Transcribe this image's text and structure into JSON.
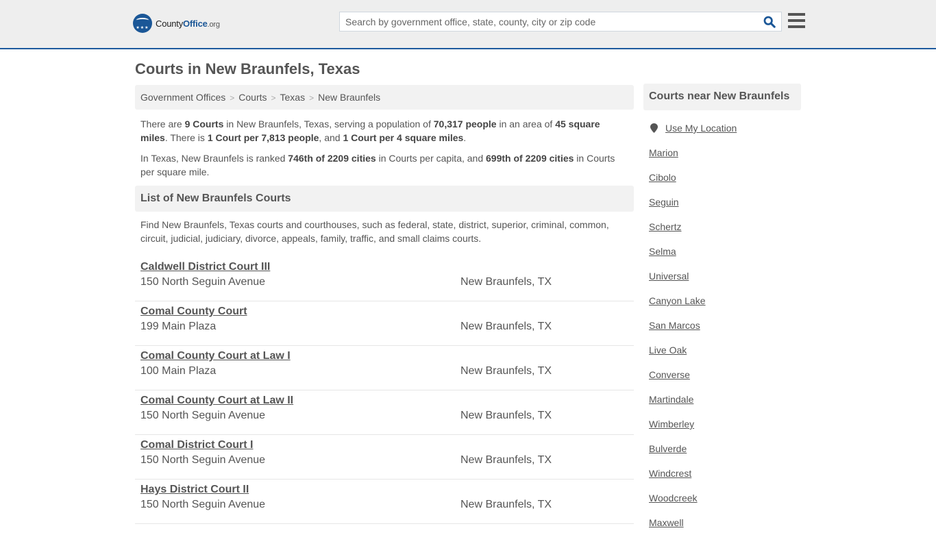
{
  "header": {
    "logo": {
      "prefix": "County",
      "brand": "Office",
      "suffix": ".org"
    },
    "search": {
      "placeholder": "Search by government office, state, county, city or zip code",
      "value": ""
    },
    "icons": {
      "search": "search-icon",
      "menu": "hamburger-menu-icon"
    }
  },
  "page": {
    "title": "Courts in New Braunfels, Texas"
  },
  "breadcrumb": [
    {
      "label": "Government Offices"
    },
    {
      "label": "Courts"
    },
    {
      "label": "Texas"
    },
    {
      "label": "New Braunfels"
    }
  ],
  "summary": {
    "p1": {
      "t1": "There are ",
      "b1": "9 Courts",
      "t2": " in New Braunfels, Texas, serving a population of ",
      "b2": "70,317 people",
      "t3": " in an area of ",
      "b3": "45 square miles",
      "t4": ". There is ",
      "b4": "1 Court per 7,813 people",
      "t5": ", and ",
      "b5": "1 Court per 4 square miles",
      "t6": "."
    },
    "p2": {
      "t1": "In Texas, New Braunfels is ranked ",
      "b1": "746th of 2209 cities",
      "t2": " in Courts per capita, and ",
      "b2": "699th of 2209 cities",
      "t3": " in Courts per square mile."
    }
  },
  "list": {
    "heading": "List of New Braunfels Courts",
    "description": "Find New Braunfels, Texas courts and courthouses, such as federal, state, district, superior, criminal, common, circuit, judicial, judiciary, divorce, appeals, family, traffic, and small claims courts.",
    "courts": [
      {
        "name": "Caldwell District Court III",
        "address": "150 North Seguin Avenue",
        "city": "New Braunfels, TX"
      },
      {
        "name": "Comal County Court",
        "address": "199 Main Plaza",
        "city": "New Braunfels, TX"
      },
      {
        "name": "Comal County Court at Law I",
        "address": "100 Main Plaza",
        "city": "New Braunfels, TX"
      },
      {
        "name": "Comal County Court at Law II",
        "address": "150 North Seguin Avenue",
        "city": "New Braunfels, TX"
      },
      {
        "name": "Comal District Court I",
        "address": "150 North Seguin Avenue",
        "city": "New Braunfels, TX"
      },
      {
        "name": "Hays District Court II",
        "address": "150 North Seguin Avenue",
        "city": "New Braunfels, TX"
      }
    ]
  },
  "sidebar": {
    "heading": "Courts near New Braunfels",
    "use_location": "Use My Location",
    "cities": [
      "Marion",
      "Cibolo",
      "Seguin",
      "Schertz",
      "Selma",
      "Universal",
      "Canyon Lake",
      "San Marcos",
      "Live Oak",
      "Converse",
      "Martindale",
      "Wimberley",
      "Bulverde",
      "Windcrest",
      "Woodcreek",
      "Maxwell"
    ]
  }
}
